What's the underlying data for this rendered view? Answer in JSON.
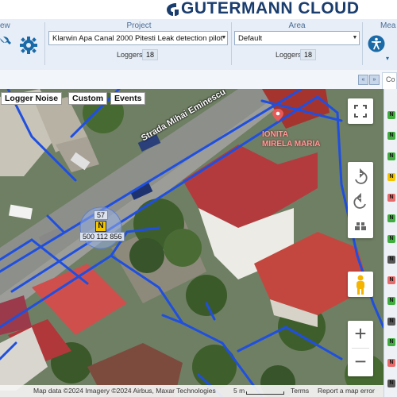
{
  "brand": {
    "name": "GUTERMANN CLOUD"
  },
  "toolbar": {
    "view_label": "ew",
    "project": {
      "label": "Project",
      "value": "Klarwin Apa Canal 2000 Pitesti Leak detection pilot",
      "loggers_label": "Loggers",
      "loggers_count": "18"
    },
    "area": {
      "label": "Area",
      "value": "Default",
      "loggers_label": "Loggers",
      "loggers_count": "18"
    },
    "measure_label": "Mea",
    "icons": [
      "wrench-icon",
      "gear-icon",
      "accessibility-icon"
    ]
  },
  "subbar": {
    "prev": "«",
    "next": "»",
    "tab_stub": "Co"
  },
  "map": {
    "buttons": {
      "logger_noise": "Logger Noise",
      "custom": "Custom",
      "events": "Events"
    },
    "street_name": "Strada Mihai Eminescu",
    "poi_name_line1": "IONITA",
    "poi_name_line2": "MIRELA MARIA",
    "marker_number": "57",
    "marker_id": "500 112 856",
    "marker_letter": "N",
    "footer": {
      "data_credit": "Map data ©2024 Imagery ©2024 Airbus, Maxar Technologies",
      "scale": "5 m",
      "terms": "Terms",
      "report": "Report a map error"
    },
    "zoom_in": "+",
    "zoom_out": "−",
    "colors": {
      "pipe": "#1f4fe0",
      "roof_red": "#b33b3e",
      "roof_brown": "#7d4a3e",
      "tree_green": "#3e5e2c",
      "road": "#8d8f8a"
    }
  },
  "side_list": [
    "N",
    "N",
    "N",
    "N",
    "N",
    "N",
    "N",
    "N",
    "N",
    "N",
    "N",
    "N",
    "N",
    "N"
  ],
  "side_colors": [
    "#3fae3f",
    "#3fae3f",
    "#3fae3f",
    "#f2c500",
    "#e86a6a",
    "#3fae3f",
    "#3fae3f",
    "#555555",
    "#e86a6a",
    "#3fae3f",
    "#555555",
    "#3fae3f",
    "#e86a6a",
    "#555555"
  ]
}
